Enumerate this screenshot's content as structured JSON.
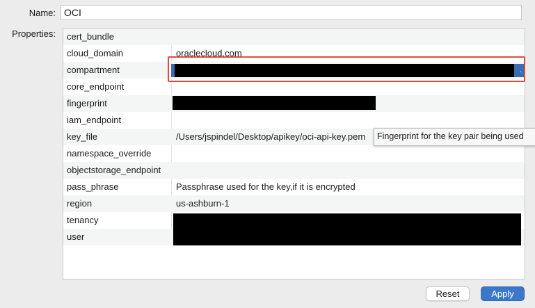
{
  "form": {
    "name_label": "Name:",
    "name_value": "OCI",
    "properties_label": "Properties:"
  },
  "properties": [
    {
      "key": "cert_bundle",
      "value": ""
    },
    {
      "key": "cloud_domain",
      "value": "oraclecloud.com"
    },
    {
      "key": "compartment",
      "value": "",
      "redacted": true,
      "selected": true
    },
    {
      "key": "core_endpoint",
      "value": ""
    },
    {
      "key": "fingerprint",
      "value": "",
      "redacted": true
    },
    {
      "key": "iam_endpoint",
      "value": ""
    },
    {
      "key": "key_file",
      "value": "/Users/jspindel/Desktop/apikey/oci-api-key.pem"
    },
    {
      "key": "namespace_override",
      "value": ""
    },
    {
      "key": "objectstorage_endpoint",
      "value": ""
    },
    {
      "key": "pass_phrase",
      "value": "Passphrase used for the key,if it is encrypted"
    },
    {
      "key": "region",
      "value": "us-ashburn-1"
    },
    {
      "key": "tenancy",
      "value": "",
      "redacted": true
    },
    {
      "key": "user",
      "value": "",
      "redacted": true
    }
  ],
  "tooltip": {
    "text": "Fingerprint for the key pair being used"
  },
  "buttons": {
    "reset_label": "Reset",
    "apply_label": "Apply"
  },
  "colors": {
    "accent": "#3c78c8",
    "selection": "#3b6db4",
    "highlight_box": "#e44a39",
    "redaction": "#000000"
  }
}
